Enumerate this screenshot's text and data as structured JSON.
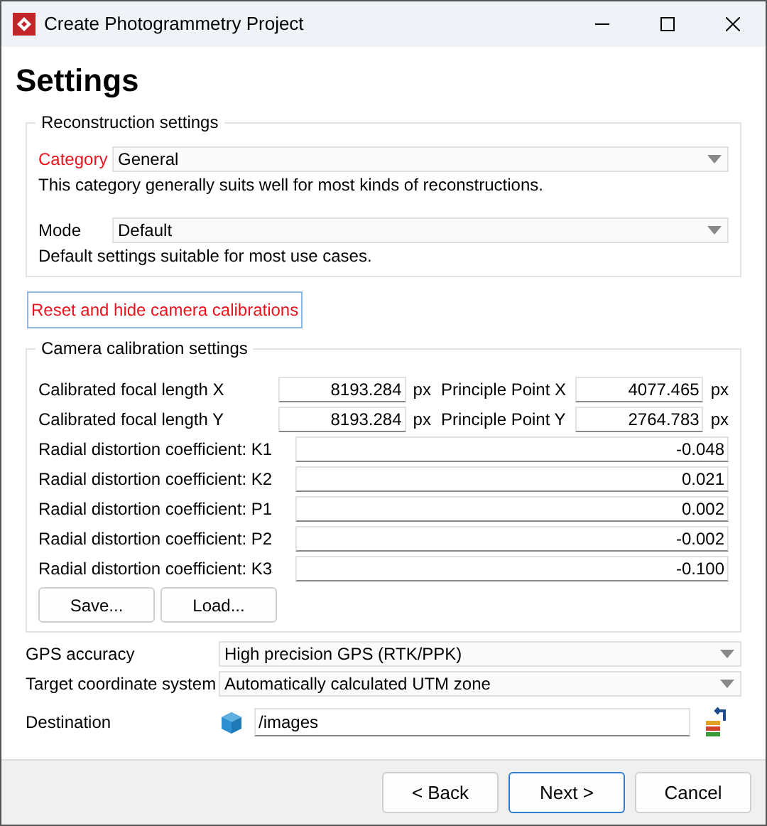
{
  "window": {
    "title": "Create Photogrammetry Project"
  },
  "heading": "Settings",
  "reconstruction": {
    "title": "Reconstruction settings",
    "fields": [
      {
        "label": "Category",
        "highlighted": true,
        "value": "General",
        "description": "This category generally suits well for most kinds of reconstructions."
      },
      {
        "label": "Mode",
        "highlighted": false,
        "value": "Default",
        "description": "Default settings suitable for most use cases."
      }
    ]
  },
  "reset_button": "Reset and hide camera calibrations",
  "calibration": {
    "title": "Camera calibration settings",
    "pairs": [
      {
        "label": "Calibrated focal length X",
        "value": "8193.284",
        "unit": "px",
        "label_2": "Principle Point X",
        "value_2": "4077.465",
        "unit_2": "px"
      },
      {
        "label": "Calibrated focal length Y",
        "value": "8193.284",
        "unit": "px",
        "label_2": "Principle Point Y",
        "value_2": "2764.783",
        "unit_2": "px"
      }
    ],
    "coefficients": [
      {
        "label": "Radial distortion coefficient: K1",
        "value": "-0.048"
      },
      {
        "label": "Radial distortion coefficient: K2",
        "value": "0.021"
      },
      {
        "label": "Radial distortion coefficient: P1",
        "value": "0.002"
      },
      {
        "label": "Radial distortion coefficient: P2",
        "value": "-0.002"
      },
      {
        "label": "Radial distortion coefficient: K3",
        "value": "-0.100"
      }
    ],
    "buttons": [
      "Save...",
      "Load..."
    ]
  },
  "options": [
    {
      "label": "GPS accuracy",
      "value": "High precision GPS (RTK/PPK)"
    },
    {
      "label": "Target coordinate system",
      "value": "Automatically calculated UTM zone"
    }
  ],
  "destination": {
    "label": "Destination",
    "value": "/images"
  },
  "footer_buttons": [
    {
      "label": "< Back",
      "default": false
    },
    {
      "label": "Next >",
      "default": true
    },
    {
      "label": "Cancel",
      "default": false
    }
  ]
}
